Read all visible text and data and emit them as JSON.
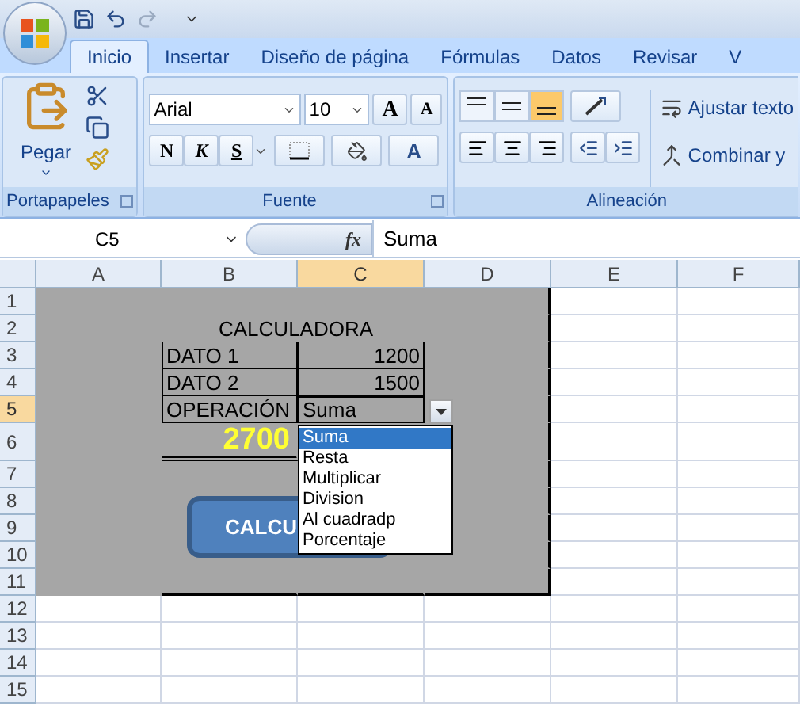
{
  "tabs": [
    {
      "label": "Inicio",
      "selected": true
    },
    {
      "label": "Insertar",
      "selected": false
    },
    {
      "label": "Diseño de página",
      "selected": false
    },
    {
      "label": "Fórmulas",
      "selected": false
    },
    {
      "label": "Datos",
      "selected": false
    },
    {
      "label": "Revisar",
      "selected": false
    },
    {
      "label": "V",
      "selected": false
    }
  ],
  "ribbon": {
    "paste_label": "Pegar",
    "font_name": "Arial",
    "font_size": "10",
    "grow_font": "A",
    "shrink_font": "A",
    "format_buttons": [
      "N",
      "K",
      "S"
    ],
    "font_color": "A",
    "vertical_align": [
      {
        "selected": false
      },
      {
        "selected": false
      },
      {
        "selected": true
      }
    ],
    "wrap_text": "Ajustar texto",
    "merge": "Combinar y",
    "groups": [
      "Portapapeles",
      "Fuente",
      "Alineación"
    ]
  },
  "formula_bar": {
    "name_box": "C5",
    "fx": "fx",
    "formula": "Suma"
  },
  "columns": [
    {
      "label": "A",
      "selected": false
    },
    {
      "label": "B",
      "selected": false
    },
    {
      "label": "C",
      "selected": true
    },
    {
      "label": "D",
      "selected": false
    },
    {
      "label": "E",
      "selected": false
    },
    {
      "label": "F",
      "selected": false
    }
  ],
  "rows": [
    {
      "label": "1",
      "selected": false
    },
    {
      "label": "2",
      "selected": false
    },
    {
      "label": "3",
      "selected": false
    },
    {
      "label": "4",
      "selected": false
    },
    {
      "label": "5",
      "selected": true
    },
    {
      "label": "6",
      "selected": false
    },
    {
      "label": "7",
      "selected": false
    },
    {
      "label": "8",
      "selected": false
    },
    {
      "label": "9",
      "selected": false
    },
    {
      "label": "10",
      "selected": false
    },
    {
      "label": "11",
      "selected": false
    },
    {
      "label": "12",
      "selected": false
    },
    {
      "label": "13",
      "selected": false
    },
    {
      "label": "14",
      "selected": false
    },
    {
      "label": "15",
      "selected": false
    }
  ],
  "sheet": {
    "title": "CALCULADORA",
    "data": [
      {
        "label": "DATO 1",
        "value": "1200"
      },
      {
        "label": "DATO 2",
        "value": "1500"
      },
      {
        "label": "OPERACIÓN",
        "value": "Suma"
      }
    ],
    "result": "2700",
    "button": "CALCU",
    "dropdown": [
      {
        "label": "Suma",
        "selected": true
      },
      {
        "label": "Resta",
        "selected": false
      },
      {
        "label": "Multiplicar",
        "selected": false
      },
      {
        "label": "Division",
        "selected": false
      },
      {
        "label": "Al cuadradp",
        "selected": false
      },
      {
        "label": "Porcentaje",
        "selected": false
      }
    ]
  }
}
